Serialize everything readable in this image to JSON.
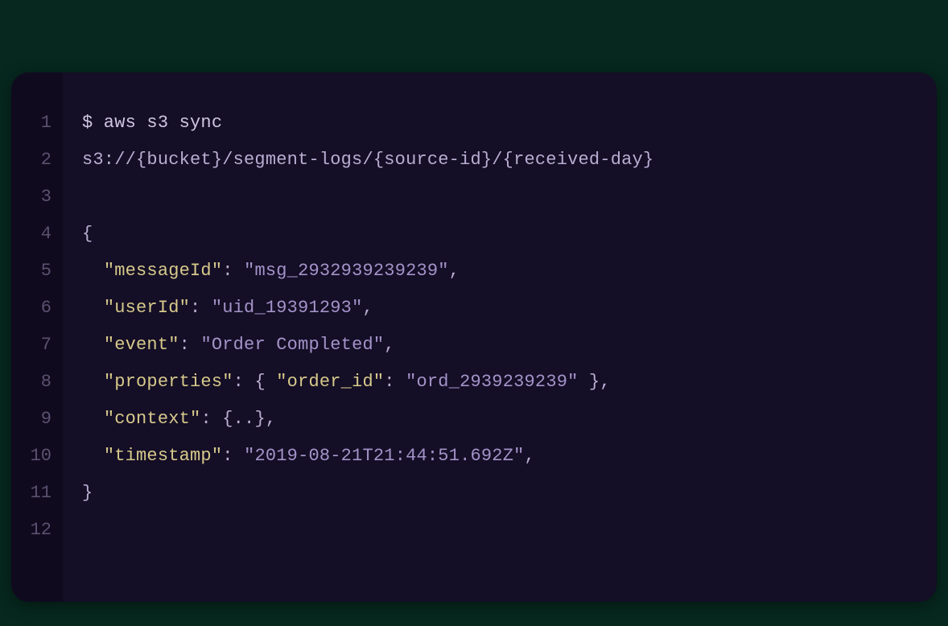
{
  "colors": {
    "page_bg": "#06281e",
    "panel_bg": "#140e26",
    "gutter_bg": "#100a1f",
    "line_num": "#5a5170",
    "plain": "#c7bede",
    "punct": "#b9aed2",
    "key": "#d7c98b",
    "string": "#a493c9"
  },
  "code": {
    "line_count": 12,
    "lines": [
      [
        {
          "cls": "tok-cmd",
          "text": "$ aws s3 sync"
        }
      ],
      [
        {
          "cls": "tok-path",
          "text": "s3://{bucket}/segment-logs/{source-id}/{received-day}"
        }
      ],
      [],
      [
        {
          "cls": "tok-punct",
          "text": "{"
        }
      ],
      [
        {
          "cls": "tok-punct",
          "text": "  "
        },
        {
          "cls": "tok-key",
          "text": "\"messageId\""
        },
        {
          "cls": "tok-punct",
          "text": ": "
        },
        {
          "cls": "tok-string",
          "text": "\"msg_2932939239239\""
        },
        {
          "cls": "tok-punct",
          "text": ","
        }
      ],
      [
        {
          "cls": "tok-punct",
          "text": "  "
        },
        {
          "cls": "tok-key",
          "text": "\"userId\""
        },
        {
          "cls": "tok-punct",
          "text": ": "
        },
        {
          "cls": "tok-string",
          "text": "\"uid_19391293\""
        },
        {
          "cls": "tok-punct",
          "text": ","
        }
      ],
      [
        {
          "cls": "tok-punct",
          "text": "  "
        },
        {
          "cls": "tok-key",
          "text": "\"event\""
        },
        {
          "cls": "tok-punct",
          "text": ": "
        },
        {
          "cls": "tok-string",
          "text": "\"Order Completed\""
        },
        {
          "cls": "tok-punct",
          "text": ","
        }
      ],
      [
        {
          "cls": "tok-punct",
          "text": "  "
        },
        {
          "cls": "tok-key",
          "text": "\"properties\""
        },
        {
          "cls": "tok-punct",
          "text": ": { "
        },
        {
          "cls": "tok-key",
          "text": "\"order_id\""
        },
        {
          "cls": "tok-punct",
          "text": ": "
        },
        {
          "cls": "tok-string",
          "text": "\"ord_2939239239\""
        },
        {
          "cls": "tok-punct",
          "text": " },"
        }
      ],
      [
        {
          "cls": "tok-punct",
          "text": "  "
        },
        {
          "cls": "tok-key",
          "text": "\"context\""
        },
        {
          "cls": "tok-punct",
          "text": ": {..},"
        }
      ],
      [
        {
          "cls": "tok-punct",
          "text": "  "
        },
        {
          "cls": "tok-key",
          "text": "\"timestamp\""
        },
        {
          "cls": "tok-punct",
          "text": ": "
        },
        {
          "cls": "tok-string",
          "text": "\"2019-08-21T21:44:51.692Z\""
        },
        {
          "cls": "tok-punct",
          "text": ","
        }
      ],
      [
        {
          "cls": "tok-punct",
          "text": "}"
        }
      ],
      []
    ]
  }
}
